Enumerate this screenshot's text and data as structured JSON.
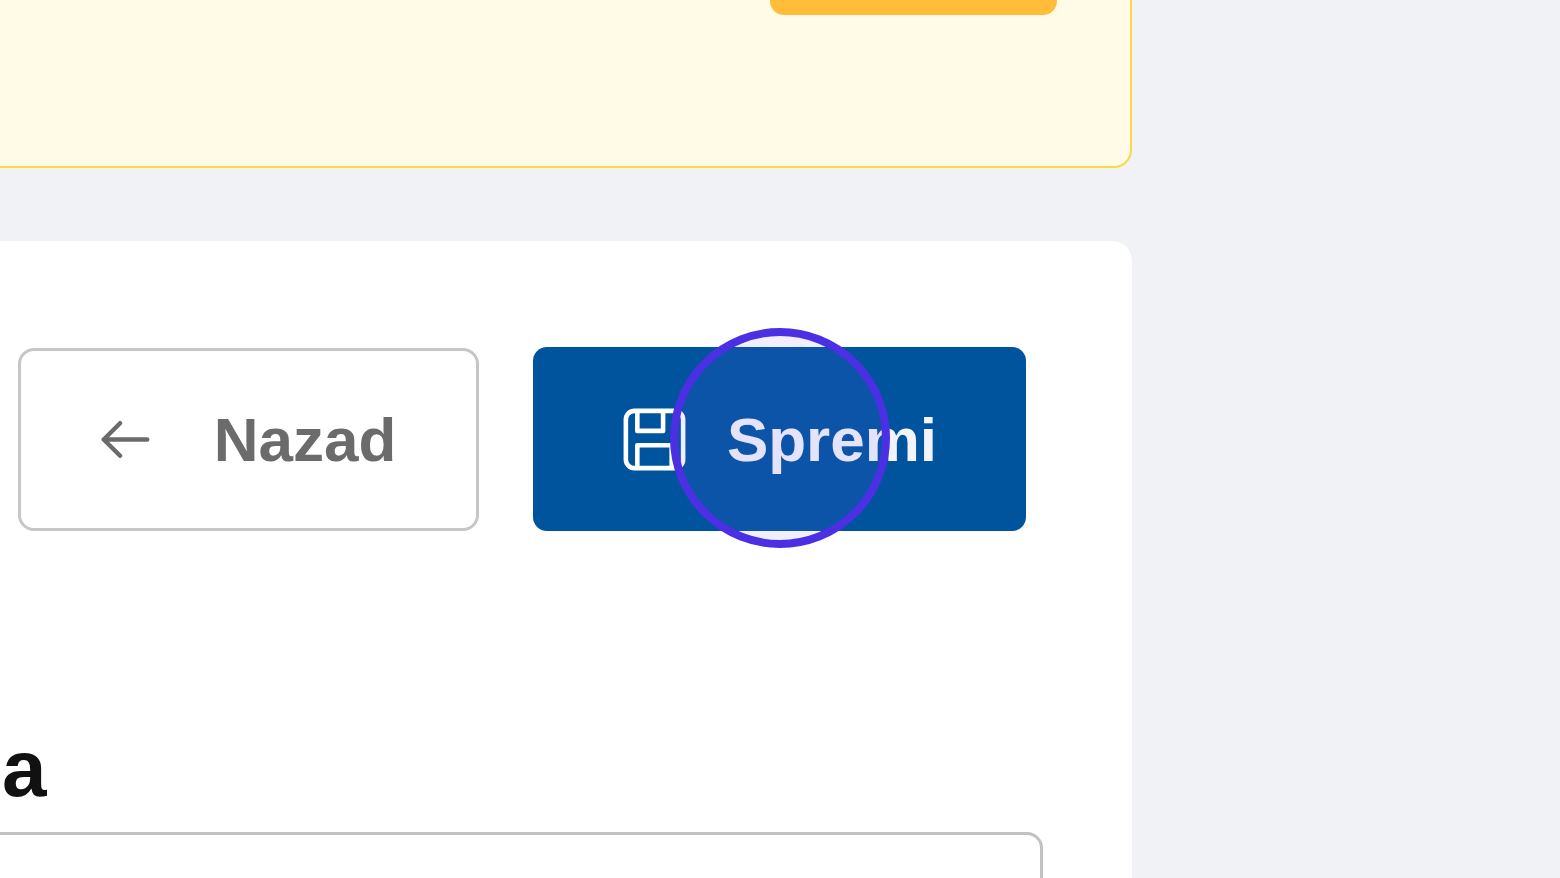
{
  "form": {
    "buttons": [
      {
        "label": "Nazad",
        "kind": "back",
        "highlighted": false
      },
      {
        "label": "Spremi",
        "kind": "save",
        "highlighted": true
      }
    ],
    "fields": [
      {
        "label": "a"
      }
    ]
  }
}
